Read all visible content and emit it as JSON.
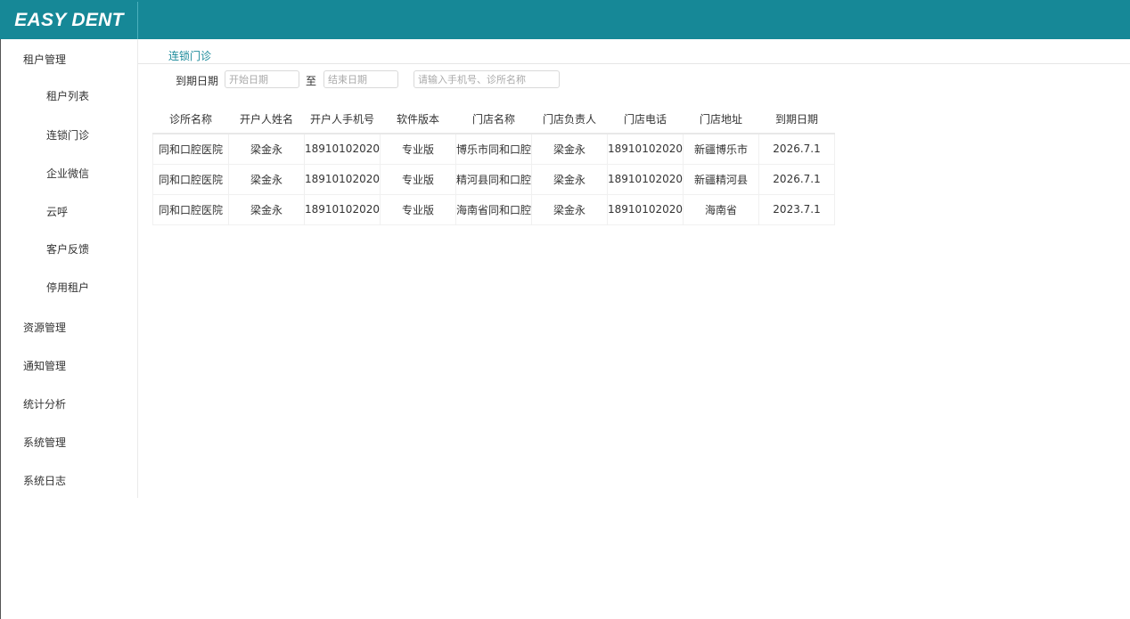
{
  "app": {
    "logo": "EASY DENT"
  },
  "sidebar": {
    "groups": [
      {
        "label": "租户管理"
      },
      {
        "label": "资源管理"
      },
      {
        "label": "通知管理"
      },
      {
        "label": "统计分析"
      },
      {
        "label": "系统管理"
      },
      {
        "label": "系统日志"
      }
    ],
    "sub_items": [
      {
        "label": "租户列表"
      },
      {
        "label": "连锁门诊"
      },
      {
        "label": "企业微信"
      },
      {
        "label": "云呼"
      },
      {
        "label": "客户反馈"
      },
      {
        "label": "停用租户"
      }
    ]
  },
  "tabs": [
    {
      "label": "连锁门诊"
    }
  ],
  "filters": {
    "date_label": "到期日期",
    "start_placeholder": "开始日期",
    "to_label": "至",
    "end_placeholder": "结束日期",
    "search_placeholder": "请输入手机号、诊所名称"
  },
  "table": {
    "columns": [
      "诊所名称",
      "开户人姓名",
      "开户人手机号",
      "软件版本",
      "门店名称",
      "门店负责人",
      "门店电话",
      "门店地址",
      "到期日期"
    ],
    "rows": [
      [
        "同和口腔医院",
        "梁金永",
        "18910102020",
        "专业版",
        "博乐市同和口腔",
        "梁金永",
        "18910102020",
        "新疆博乐市",
        "2026.7.1"
      ],
      [
        "同和口腔医院",
        "梁金永",
        "18910102020",
        "专业版",
        "精河县同和口腔",
        "梁金永",
        "18910102020",
        "新疆精河县",
        "2026.7.1"
      ],
      [
        "同和口腔医院",
        "梁金永",
        "18910102020",
        "专业版",
        "海南省同和口腔",
        "梁金永",
        "18910102020",
        "海南省",
        "2023.7.1"
      ]
    ]
  },
  "colors": {
    "header": "#168897",
    "accent": "#1b8a9a"
  }
}
